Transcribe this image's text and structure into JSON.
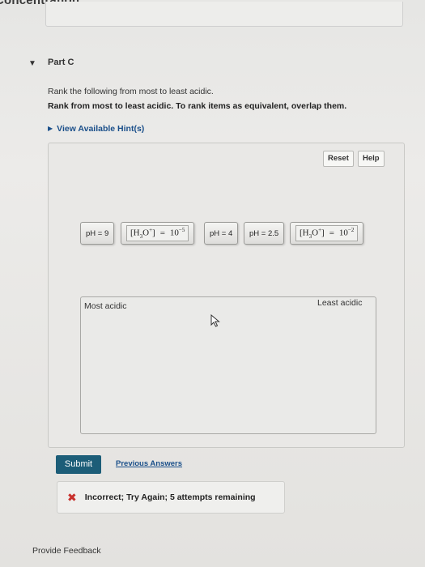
{
  "page": {
    "header_text": "Concentration"
  },
  "part": {
    "title": "Part C",
    "toggle_icon": "caret-down-icon",
    "instruction": "Rank the following from most to least acidic.",
    "instruction_bold": "Rank from most to least acidic. To rank items as equivalent, overlap them.",
    "hint_link": "View Available Hint(s)"
  },
  "toolbar": {
    "reset_label": "Reset",
    "help_label": "Help"
  },
  "tiles": [
    {
      "label": "pH = 9"
    },
    {
      "label": "[H3O+] = 10^-5",
      "species": "H",
      "sub": "3",
      "o": "O",
      "sup": "+",
      "value": "10",
      "exp": "−5"
    },
    {
      "label": "pH = 4"
    },
    {
      "label": "pH = 2.5"
    },
    {
      "label": "[H3O+] = 10^-2",
      "species": "H",
      "sub": "3",
      "o": "O",
      "sup": "+",
      "value": "10",
      "exp": "−2"
    }
  ],
  "drop_zone": {
    "left_label": "Most acidic",
    "right_label": "Least acidic"
  },
  "actions": {
    "submit_label": "Submit",
    "previous_answers_label": "Previous Answers"
  },
  "feedback": {
    "icon": "x-icon",
    "icon_color": "#c8302c",
    "message": "Incorrect; Try Again; 5 attempts remaining"
  },
  "footer": {
    "provide_feedback": "Provide Feedback"
  },
  "colors": {
    "submit_bg": "#1c5d78",
    "link": "#1a4f8a"
  }
}
